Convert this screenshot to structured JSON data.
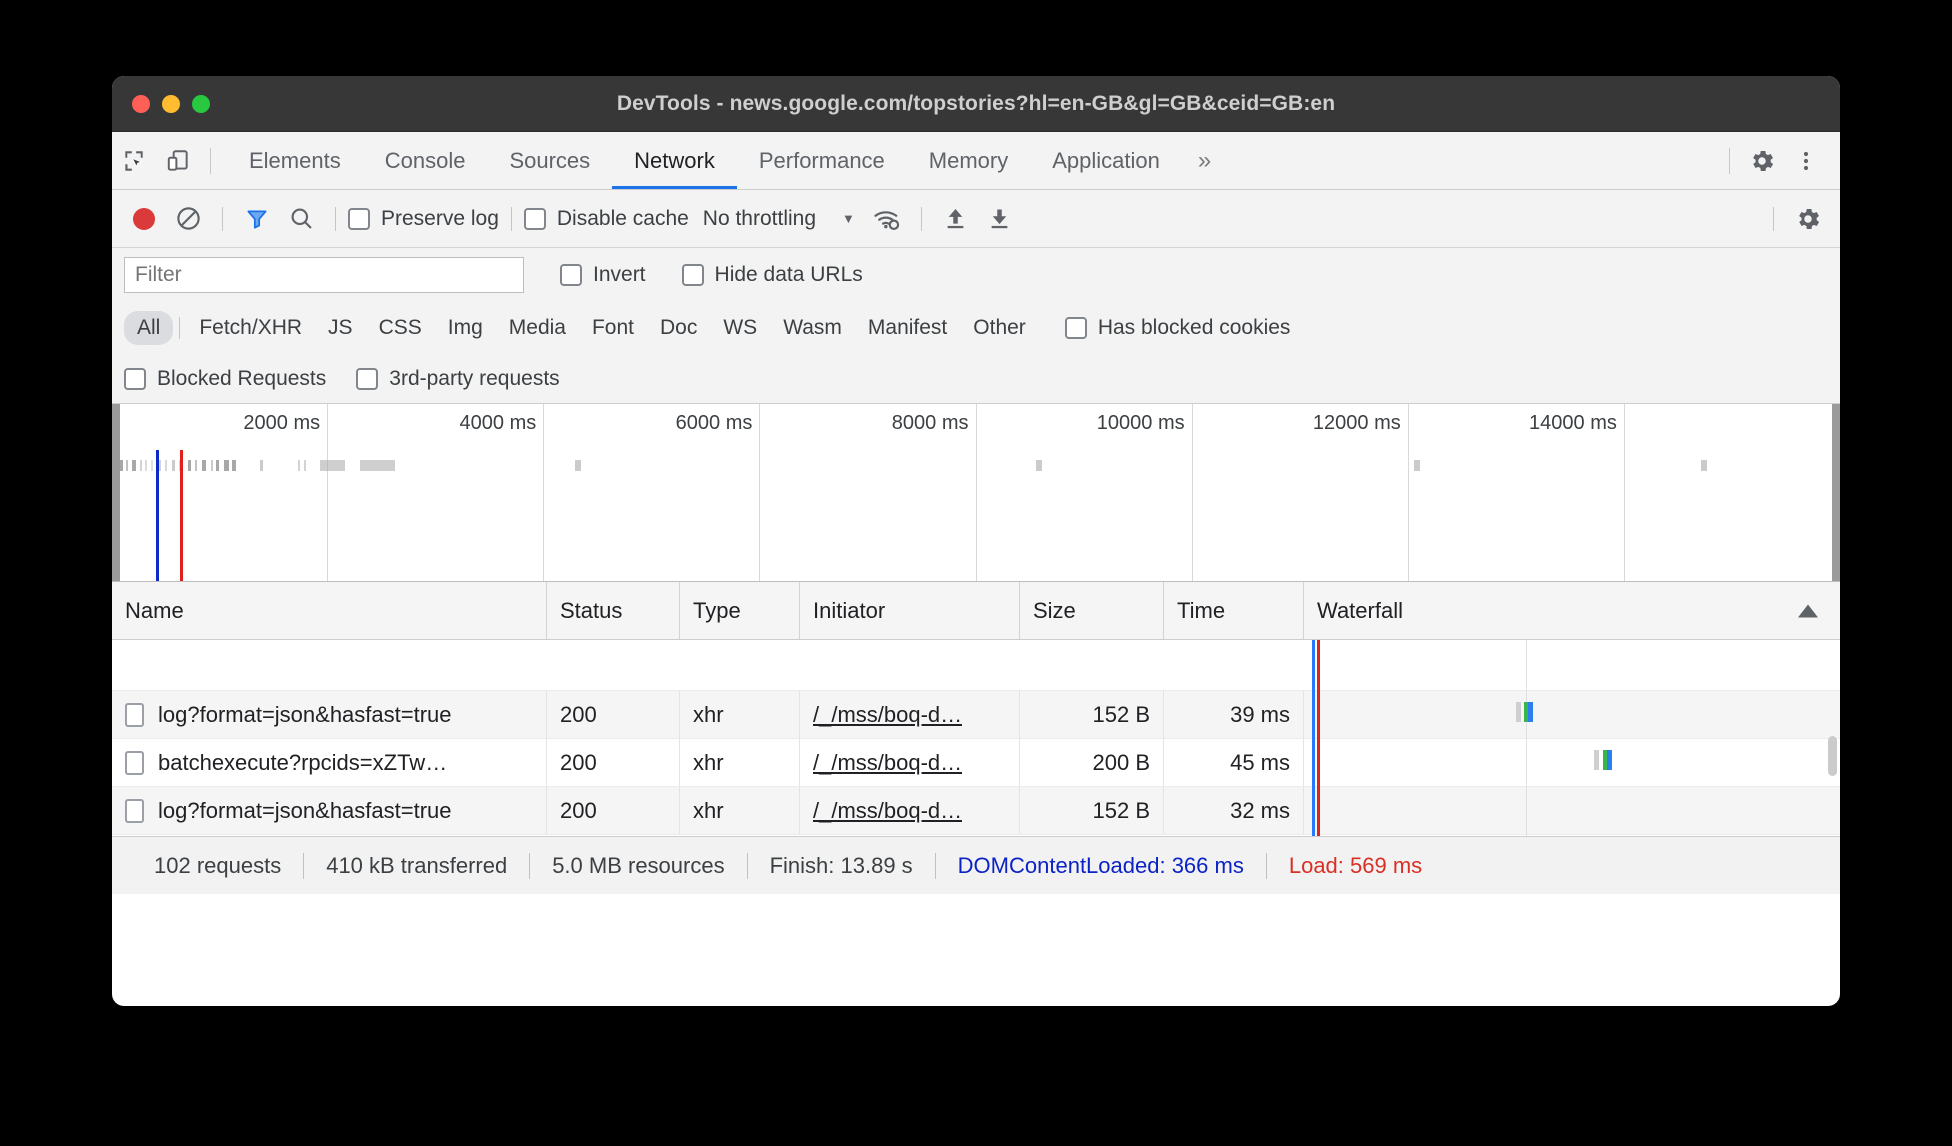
{
  "window": {
    "title": "DevTools - news.google.com/topstories?hl=en-GB&gl=GB&ceid=GB:en",
    "traffic": {
      "close": "close",
      "minimize": "minimize",
      "zoom": "zoom"
    }
  },
  "main_tabs": {
    "icons": {
      "inspect": "inspect-element-icon",
      "device": "device-toolbar-icon",
      "settings": "gear-icon",
      "more": "more-vertical-icon"
    },
    "more_label": "»",
    "items": [
      {
        "label": "Elements",
        "active": false
      },
      {
        "label": "Console",
        "active": false
      },
      {
        "label": "Sources",
        "active": false
      },
      {
        "label": "Network",
        "active": true
      },
      {
        "label": "Performance",
        "active": false
      },
      {
        "label": "Memory",
        "active": false
      },
      {
        "label": "Application",
        "active": false
      }
    ]
  },
  "network_toolbar": {
    "record": {
      "name": "record-button",
      "state": "recording"
    },
    "clear": {
      "name": "clear-button"
    },
    "filter_toggle": {
      "name": "filter-icon",
      "state": "active"
    },
    "search": {
      "name": "search-icon"
    },
    "preserve_log": {
      "label": "Preserve log",
      "checked": false
    },
    "disable_cache": {
      "label": "Disable cache",
      "checked": false
    },
    "throttling": {
      "value": "No throttling"
    },
    "wifi_icon": "wifi-settings-icon",
    "import_har": "upload-icon",
    "export_har": "download-icon",
    "settings": "gear-icon"
  },
  "filter_bar": {
    "placeholder": "Filter",
    "value": "",
    "invert": {
      "label": "Invert",
      "checked": false
    },
    "hide_data_urls": {
      "label": "Hide data URLs",
      "checked": false
    }
  },
  "type_filters": {
    "items": [
      {
        "label": "All",
        "selected": true
      },
      {
        "label": "Fetch/XHR",
        "selected": false
      },
      {
        "label": "JS",
        "selected": false
      },
      {
        "label": "CSS",
        "selected": false
      },
      {
        "label": "Img",
        "selected": false
      },
      {
        "label": "Media",
        "selected": false
      },
      {
        "label": "Font",
        "selected": false
      },
      {
        "label": "Doc",
        "selected": false
      },
      {
        "label": "WS",
        "selected": false
      },
      {
        "label": "Wasm",
        "selected": false
      },
      {
        "label": "Manifest",
        "selected": false
      },
      {
        "label": "Other",
        "selected": false
      }
    ],
    "has_blocked_cookies": {
      "label": "Has blocked cookies",
      "checked": false
    },
    "blocked_requests": {
      "label": "Blocked Requests",
      "checked": false
    },
    "third_party_requests": {
      "label": "3rd-party requests",
      "checked": false
    }
  },
  "overview": {
    "ticks": [
      "2000 ms",
      "4000 ms",
      "6000 ms",
      "8000 ms",
      "10000 ms",
      "12000 ms",
      "14000 ms"
    ],
    "dom_content_loaded_color": "#0d29c9",
    "load_color": "#e0201a"
  },
  "table": {
    "columns": [
      {
        "key": "name",
        "label": "Name"
      },
      {
        "key": "status",
        "label": "Status"
      },
      {
        "key": "type",
        "label": "Type"
      },
      {
        "key": "initiator",
        "label": "Initiator"
      },
      {
        "key": "size",
        "label": "Size"
      },
      {
        "key": "time",
        "label": "Time"
      },
      {
        "key": "waterfall",
        "label": "Waterfall"
      }
    ],
    "sort": {
      "column": "waterfall",
      "direction": "ascending"
    },
    "rows": [
      {
        "name": "log?format=json&hasfast=true",
        "status": "200",
        "type": "xhr",
        "initiator": "/_/mss/boq-d…",
        "size": "152 B",
        "time": "39 ms"
      },
      {
        "name": "batchexecute?rpcids=xZTw…",
        "status": "200",
        "type": "xhr",
        "initiator": "/_/mss/boq-d…",
        "size": "200 B",
        "time": "45 ms"
      },
      {
        "name": "log?format=json&hasfast=true",
        "status": "200",
        "type": "xhr",
        "initiator": "/_/mss/boq-d…",
        "size": "152 B",
        "time": "32 ms"
      }
    ]
  },
  "status_bar": {
    "requests": "102 requests",
    "transferred": "410 kB transferred",
    "resources": "5.0 MB resources",
    "finish": "Finish: 13.89 s",
    "dom_content_loaded": "DOMContentLoaded: 366 ms",
    "load": "Load: 569 ms"
  },
  "colors": {
    "accent": "#1a73e8",
    "record_red": "#db3a3a",
    "dcl_blue": "#0b23c4",
    "load_red": "#d93025",
    "waterfall_queue": "#cfcfcf",
    "waterfall_ttfb": "#3ab54a",
    "waterfall_download": "#2d7ff0"
  }
}
